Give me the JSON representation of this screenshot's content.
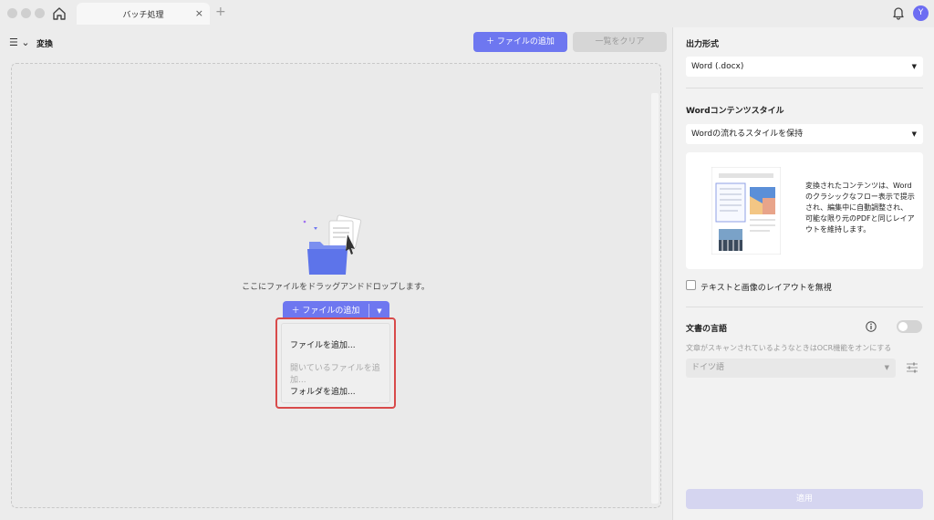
{
  "titlebar": {
    "tab_title": "バッチ処理",
    "tab_close": "×",
    "new_tab": "+",
    "avatar_letter": "Y",
    "icons": [
      "home-icon",
      "bell-icon"
    ]
  },
  "toolbar": {
    "menu_glyph": "☰ ⌄",
    "section_title": "変換",
    "add_files_label": "＋  ファイルの追加",
    "clear_list_label": "一覧をクリア"
  },
  "dropzone": {
    "instruction": "ここにファイルをドラッグアンドドロップします。",
    "add_files_label": "＋  ファイルの追加",
    "dropdown_arrow": "▼",
    "menu": {
      "add_files": "ファイルを追加...",
      "add_open_files": "開いているファイルを追加...",
      "add_folder": "フォルダを追加..."
    }
  },
  "panel": {
    "output_format_label": "出力形式",
    "output_format_value": "Word (.docx)",
    "content_style_label": "Wordコンテンツスタイル",
    "content_style_value": "Wordの流れるスタイルを保持",
    "content_style_description": "変換されたコンテンツは、Wordのクラシックなフロー表示で提示され、編集中に自動調整され、可能な限り元のPDFと同じレイアウトを維持します。",
    "ignore_layout_label": "テキストと画像のレイアウトを無視",
    "ignore_layout_checked": false,
    "doc_language_label": "文書の言語",
    "ocr_enabled": false,
    "ocr_hint": "文章がスキャンされているようなときはOCR機能をオンにする",
    "language_value": "ドイツ語",
    "caret": "▼",
    "apply_label": "適用"
  },
  "colors": {
    "accent": "#6e77f0",
    "highlight_border": "#d84a4a",
    "apply_disabled": "#d5d5f0"
  }
}
